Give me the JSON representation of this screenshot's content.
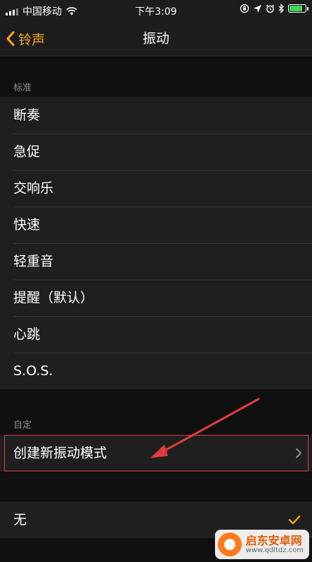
{
  "status_bar": {
    "carrier": "中国移动",
    "time": "下午3:09"
  },
  "nav": {
    "back_label": "铃声",
    "title": "振动"
  },
  "sections": {
    "standard": {
      "header": "标准",
      "items": [
        {
          "label": "断奏"
        },
        {
          "label": "急促"
        },
        {
          "label": "交响乐"
        },
        {
          "label": "快速"
        },
        {
          "label": "轻重音"
        },
        {
          "label": "提醒（默认）"
        },
        {
          "label": "心跳"
        },
        {
          "label": "S.O.S."
        }
      ]
    },
    "custom": {
      "header": "自定",
      "create_label": "创建新振动模式"
    },
    "none": {
      "label": "无",
      "selected": true
    }
  },
  "watermark": {
    "name": "启东安卓网",
    "url": "www.qdltdz.com"
  },
  "colors": {
    "accent": "#f5a623",
    "highlight_box": "#e03c3c",
    "battery": "#3ed65a"
  }
}
